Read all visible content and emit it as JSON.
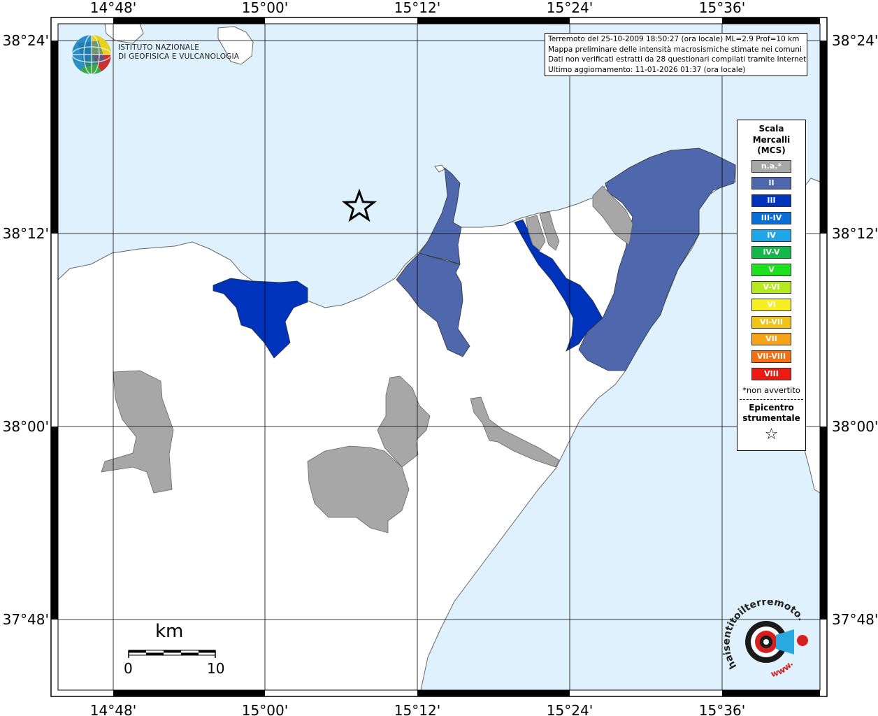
{
  "map": {
    "lon_labels": [
      "14°48'",
      "15°00'",
      "15°12'",
      "15°24'",
      "15°36'"
    ],
    "lat_labels": [
      "38°24'",
      "38°12'",
      "38°00'",
      "37°48'"
    ],
    "info_lines": [
      "Terremoto del 25-10-2009 18:50:27 (ora locale) ML=2.9 Prof=10 km",
      "Mappa preliminare delle intensità macrosismiche stimate nei comuni",
      "Dati non verificati estratti da 28 questionari compilati tramite Internet.",
      "Ultimo aggiornamento: 11-01-2026 01:37 (ora locale)"
    ],
    "colors": {
      "sea": "#dff1fc",
      "land": "#ffffff",
      "na": "#a7a7a7",
      "II": "#4f68ad",
      "III": "#0033bb"
    }
  },
  "logo": {
    "line1": "ISTITUTO NAZIONALE",
    "line2": "DI GEOFISICA E VULCANOLOGIA"
  },
  "legend": {
    "title_lines": [
      "Scala",
      "Mercalli",
      "(MCS)"
    ],
    "items": [
      {
        "label": "n.a.*",
        "color": "#a7a7a7"
      },
      {
        "label": "II",
        "color": "#4f68ad"
      },
      {
        "label": "III",
        "color": "#0033bb"
      },
      {
        "label": "III-IV",
        "color": "#0b6fd8"
      },
      {
        "label": "IV",
        "color": "#1ea6e8"
      },
      {
        "label": "IV-V",
        "color": "#12b84a"
      },
      {
        "label": "V",
        "color": "#1fe01f"
      },
      {
        "label": "V-VI",
        "color": "#b5e81d"
      },
      {
        "label": "VI",
        "color": "#f6f023"
      },
      {
        "label": "VI-VII",
        "color": "#f2c417"
      },
      {
        "label": "VII",
        "color": "#f6a317"
      },
      {
        "label": "VII-VIII",
        "color": "#f56f12"
      },
      {
        "label": "VIII",
        "color": "#ee1b13"
      }
    ],
    "note": "*non avvertito",
    "epicenter_lines": [
      "Epicentro",
      "strumentale"
    ],
    "epicenter_symbol": "☆"
  },
  "scalebar": {
    "unit": "km",
    "min": "0",
    "max": "10"
  },
  "hsit_logo": {
    "text": "haisentitoilterremoto.it",
    "www": "www."
  }
}
